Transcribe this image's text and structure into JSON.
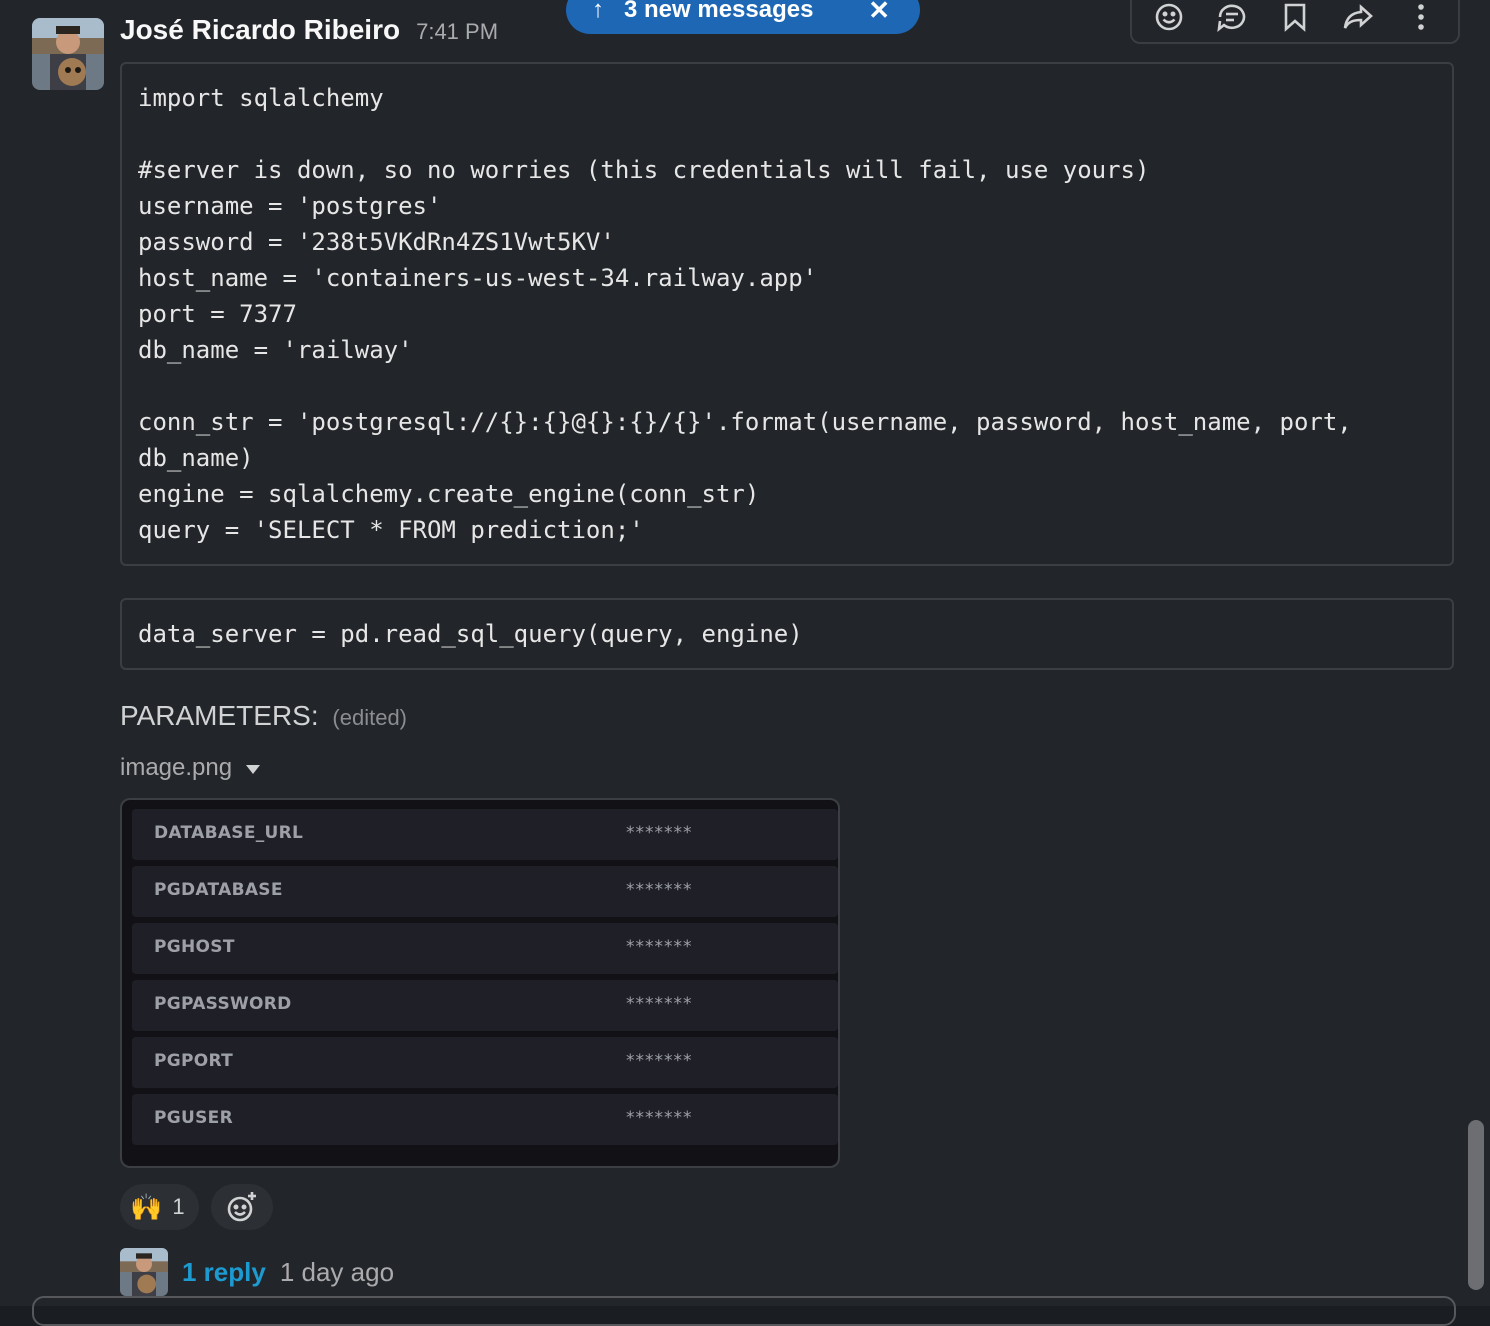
{
  "banner": {
    "label": "3 new messages",
    "up_arrow": "↑",
    "close": "✕"
  },
  "message": {
    "author": "José Ricardo Ribeiro",
    "time": "7:41 PM",
    "code_block_1": "import sqlalchemy\n\n#server is down, so no worries (this credentials will fail, use yours)\nusername = 'postgres'\npassword = '238t5VKdRn4ZS1Vwt5KV'\nhost_name = 'containers-us-west-34.railway.app'\nport = 7377\ndb_name = 'railway'\n\nconn_str = 'postgresql://{}:{}@{}:{}/{}'.format(username, password, host_name, port, db_name)\nengine = sqlalchemy.create_engine(conn_str)\nquery = 'SELECT * FROM prediction;'",
    "code_block_2": "data_server = pd.read_sql_query(query, engine)",
    "text": "PARAMETERS:",
    "edited": "(edited)",
    "attachment_name": "image.png"
  },
  "env_vars": [
    {
      "key": "DATABASE_URL",
      "value": "*******"
    },
    {
      "key": "PGDATABASE",
      "value": "*******"
    },
    {
      "key": "PGHOST",
      "value": "*******"
    },
    {
      "key": "PGPASSWORD",
      "value": "*******"
    },
    {
      "key": "PGPORT",
      "value": "*******"
    },
    {
      "key": "PGUSER",
      "value": "*******"
    }
  ],
  "reactions": [
    {
      "emoji": "🙌",
      "count": "1"
    }
  ],
  "thread": {
    "reply_count": "1 reply",
    "last_reply": "1 day ago"
  },
  "icons": {
    "actions": [
      "add-reaction-icon",
      "reply-in-thread-icon",
      "save-bookmark-icon",
      "share-forward-icon",
      "more-actions-icon"
    ]
  },
  "colors": {
    "background": "#222529",
    "banner": "#1d67b4",
    "link": "#1d9bd1"
  }
}
